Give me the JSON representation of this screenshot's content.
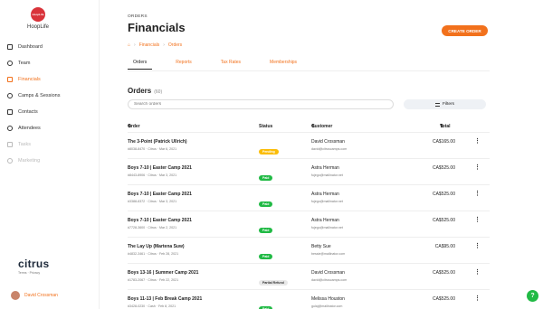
{
  "brand": {
    "logo_text": "HoopLife",
    "name": "HoopLife"
  },
  "sidebar": {
    "items": [
      {
        "label": "Dashboard",
        "icon": "grid-icon",
        "state": "normal"
      },
      {
        "label": "Team",
        "icon": "users-icon",
        "state": "normal"
      },
      {
        "label": "Financials",
        "icon": "money-icon",
        "state": "active"
      },
      {
        "label": "Camps & Sessions",
        "icon": "calendar-icon",
        "state": "normal"
      },
      {
        "label": "Contacts",
        "icon": "contacts-icon",
        "state": "normal"
      },
      {
        "label": "Attendees",
        "icon": "people-icon",
        "state": "normal"
      },
      {
        "label": "Tasks",
        "icon": "tasks-icon",
        "state": "disabled"
      },
      {
        "label": "Marketing",
        "icon": "megaphone-icon",
        "state": "disabled"
      }
    ]
  },
  "footer": {
    "logo": "citrus",
    "links": "Terms · Privacy",
    "user_name": "David Crossman"
  },
  "header": {
    "section": "ORDERS",
    "title": "Financials",
    "breadcrumb": [
      "Financials",
      "Orders"
    ],
    "create_label": "CREATE ORDER"
  },
  "tabs": [
    "Orders",
    "Reports",
    "Tax Rates",
    "Memberships"
  ],
  "orders": {
    "title": "Orders",
    "count": "(60)",
    "search_placeholder": "Search orders",
    "filters_label": "Filters",
    "columns": {
      "order": "Order",
      "status": "Status",
      "customer": "Customer",
      "total": "Total"
    },
    "rows": [
      {
        "name": "The 3-Point (Patrick Ullrich)",
        "meta": "#8038-8470 · Citrus · Mar 6, 2021",
        "status": "Pending",
        "status_type": "pending",
        "customer": "David Crossman",
        "email": "david@citruscamps.com",
        "total": "CA$165.00"
      },
      {
        "name": "Boys 7-10 | Easter Camp 2021",
        "meta": "#8443-8906 · Citrus · Mar 3, 2021",
        "status": "Paid",
        "status_type": "paid",
        "customer": "Astra Herman",
        "email": "fujego@mailinator.net",
        "total": "CA$525.00"
      },
      {
        "name": "Boys 7-10 | Easter Camp 2021",
        "meta": "#3388-8372 · Citrus · Mar 3, 2021",
        "status": "Paid",
        "status_type": "paid",
        "customer": "Astra Herman",
        "email": "fujego@mailinator.net",
        "total": "CA$525.00"
      },
      {
        "name": "Boys 7-10 | Easter Camp 2021",
        "meta": "#7728-3600 · Citrus · Mar 2, 2021",
        "status": "Paid",
        "status_type": "paid",
        "customer": "Astra Herman",
        "email": "fujego@mailinator.net",
        "total": "CA$525.00"
      },
      {
        "name": "The Lay Up (Martena Suw)",
        "meta": "#4832-3461 · Citrus · Feb 28, 2021",
        "status": "Paid",
        "status_type": "paid",
        "customer": "Betty Sue",
        "email": "bessie@mailinator.com",
        "total": "CA$95.00"
      },
      {
        "name": "Boys 13-16 | Summer Camp 2021",
        "meta": "#1783-2067 · Citrus · Feb 22, 2021",
        "status": "Partial Refund",
        "status_type": "partial",
        "customer": "David Crossman",
        "email": "david@citruscamps.com",
        "total": "CA$525.00"
      },
      {
        "name": "Boys 11-13 | Feb Break Camp 2021",
        "meta": "#3428-0230 · Cash · Feb 8, 2021",
        "status": "Paid",
        "status_type": "paid",
        "customer": "Melissa Houston",
        "email": "gulaj@mailinator.com",
        "total": "CA$525.00"
      }
    ]
  },
  "help_label": "?"
}
